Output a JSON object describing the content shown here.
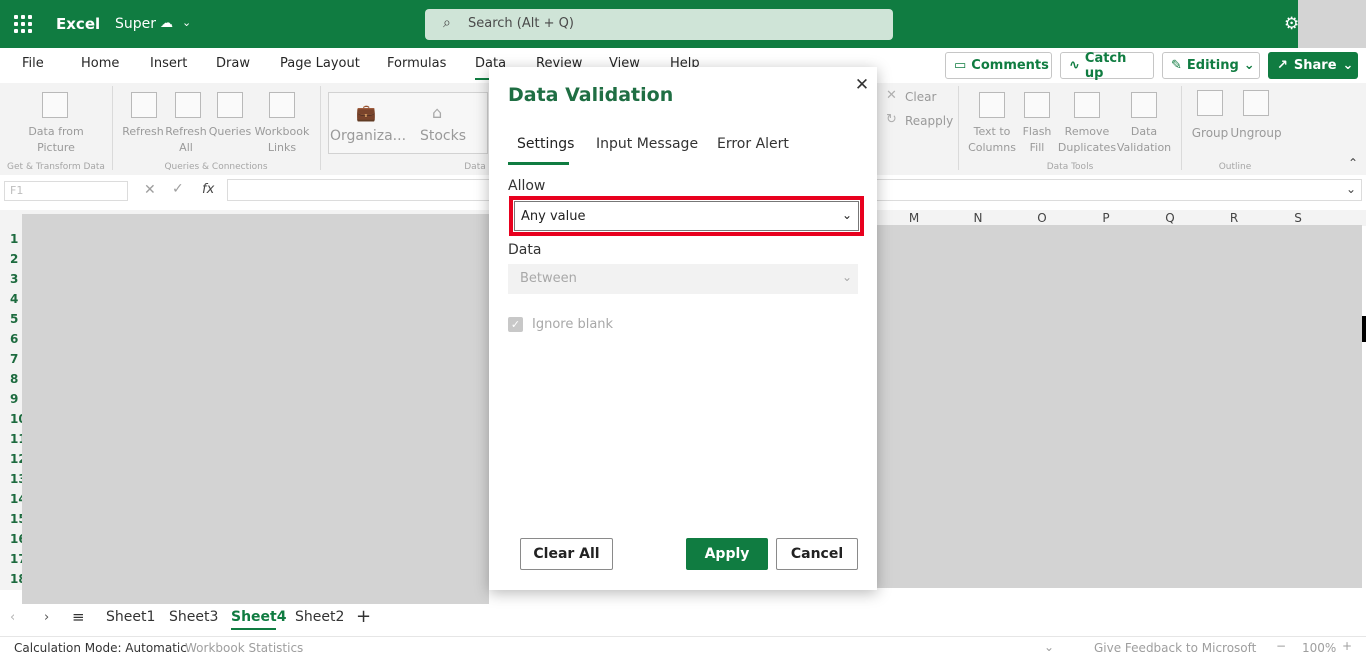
{
  "title_bar": {
    "app_name": "Excel",
    "doc_name": "Super",
    "search_placeholder": "Search (Alt + Q)",
    "bg_color": "#107c41"
  },
  "menu": {
    "items": [
      "File",
      "Home",
      "Insert",
      "Draw",
      "Page Layout",
      "Formulas",
      "Data",
      "Review",
      "View",
      "Help"
    ],
    "active": "Data"
  },
  "top_buttons": {
    "comments": "Comments",
    "catch_up": "Catch up",
    "editing": "Editing",
    "share": "Share"
  },
  "ribbon": {
    "data_from_picture": "Data from Picture",
    "refresh": "Refresh",
    "refresh_all": "Refresh All",
    "queries": "Queries",
    "workbook_links": "Workbook Links",
    "organization": "Organiza...",
    "stocks": "Stocks",
    "clear": "Clear",
    "reapply": "Reapply",
    "text_to_columns": "Text to Columns",
    "flash_fill": "Flash Fill",
    "remove_duplicates": "Remove Duplicates",
    "data_validation": "Data Validation",
    "group": "Group",
    "ungroup": "Ungroup",
    "groups": {
      "get_transform": "Get & Transform Data",
      "queries_connections": "Queries & Connections",
      "data_types": "Data",
      "data_tools": "Data Tools",
      "outline": "Outline"
    }
  },
  "formula_bar": {
    "name_box": "F1",
    "fx": "fx"
  },
  "grid": {
    "columns": [
      "M",
      "N",
      "O",
      "P",
      "Q",
      "R",
      "S"
    ],
    "rows": [
      "1",
      "2",
      "3",
      "4",
      "5",
      "6",
      "7",
      "8",
      "9",
      "10",
      "11",
      "12",
      "13",
      "14",
      "15",
      "16",
      "17",
      "18"
    ]
  },
  "sheet_tabs": {
    "tabs": [
      "Sheet1",
      "Sheet3",
      "Sheet4",
      "Sheet2"
    ],
    "active": "Sheet4"
  },
  "status_bar": {
    "calc_mode": "Calculation Mode: Automatic",
    "workbook_stats": "Workbook Statistics",
    "feedback": "Give Feedback to Microsoft",
    "zoom": "100%"
  },
  "dialog": {
    "title": "Data Validation",
    "tabs": [
      "Settings",
      "Input Message",
      "Error Alert"
    ],
    "active_tab": "Settings",
    "allow_label": "Allow",
    "allow_value": "Any value",
    "data_label": "Data",
    "data_value": "Between",
    "ignore_blank_label": "Ignore blank",
    "ignore_blank_checked": true,
    "clear_all": "Clear All",
    "apply": "Apply",
    "cancel": "Cancel",
    "highlight_color": "#e8001e"
  }
}
